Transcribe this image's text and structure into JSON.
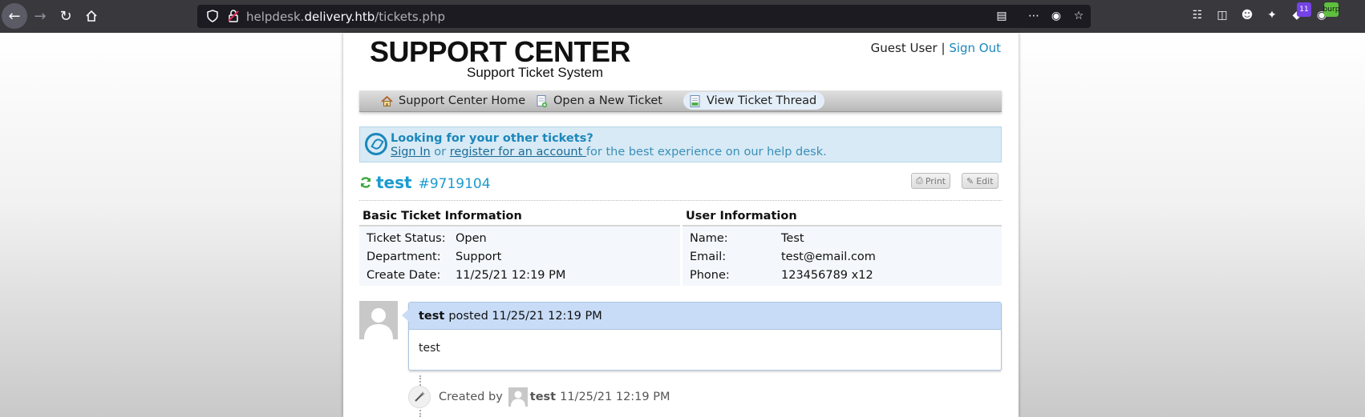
{
  "browser": {
    "url_prefix": "helpdesk.",
    "url_domain": "delivery.htb",
    "url_path": "/tickets.php",
    "extension_badge_count": "11",
    "burp_label": "burp"
  },
  "header": {
    "title": "SUPPORT CENTER",
    "subtitle": "Support Ticket System",
    "guest_user": "Guest User",
    "separator": "|",
    "sign_out": "Sign Out"
  },
  "nav": {
    "items": [
      {
        "label": "Support Center Home"
      },
      {
        "label": "Open a New Ticket"
      },
      {
        "label": "View Ticket Thread"
      }
    ]
  },
  "banner": {
    "title": "Looking for your other tickets?",
    "sign_in": "Sign In",
    "or": " or ",
    "register": "register for an account ",
    "rest": "for the best experience on our help desk."
  },
  "ticket": {
    "subject": "test",
    "number": "#9719104",
    "print_label": "Print",
    "edit_label": "Edit"
  },
  "basic_info": {
    "heading": "Basic Ticket Information",
    "rows": [
      {
        "key": "Ticket Status:",
        "value": "Open"
      },
      {
        "key": "Department:",
        "value": "Support"
      },
      {
        "key": "Create Date:",
        "value": "11/25/21 12:19 PM"
      }
    ]
  },
  "user_info": {
    "heading": "User Information",
    "rows": [
      {
        "key": "Name:",
        "value": "Test"
      },
      {
        "key": "Email:",
        "value": "test@email.com"
      },
      {
        "key": "Phone:",
        "value": "123456789 x12"
      }
    ]
  },
  "thread": {
    "entry_author": "test",
    "entry_posted": "posted 11/25/21 12:19 PM",
    "entry_body": "test",
    "event_prefix": "Created by",
    "event_user": "test",
    "event_time": "11/25/21 12:19 PM"
  }
}
